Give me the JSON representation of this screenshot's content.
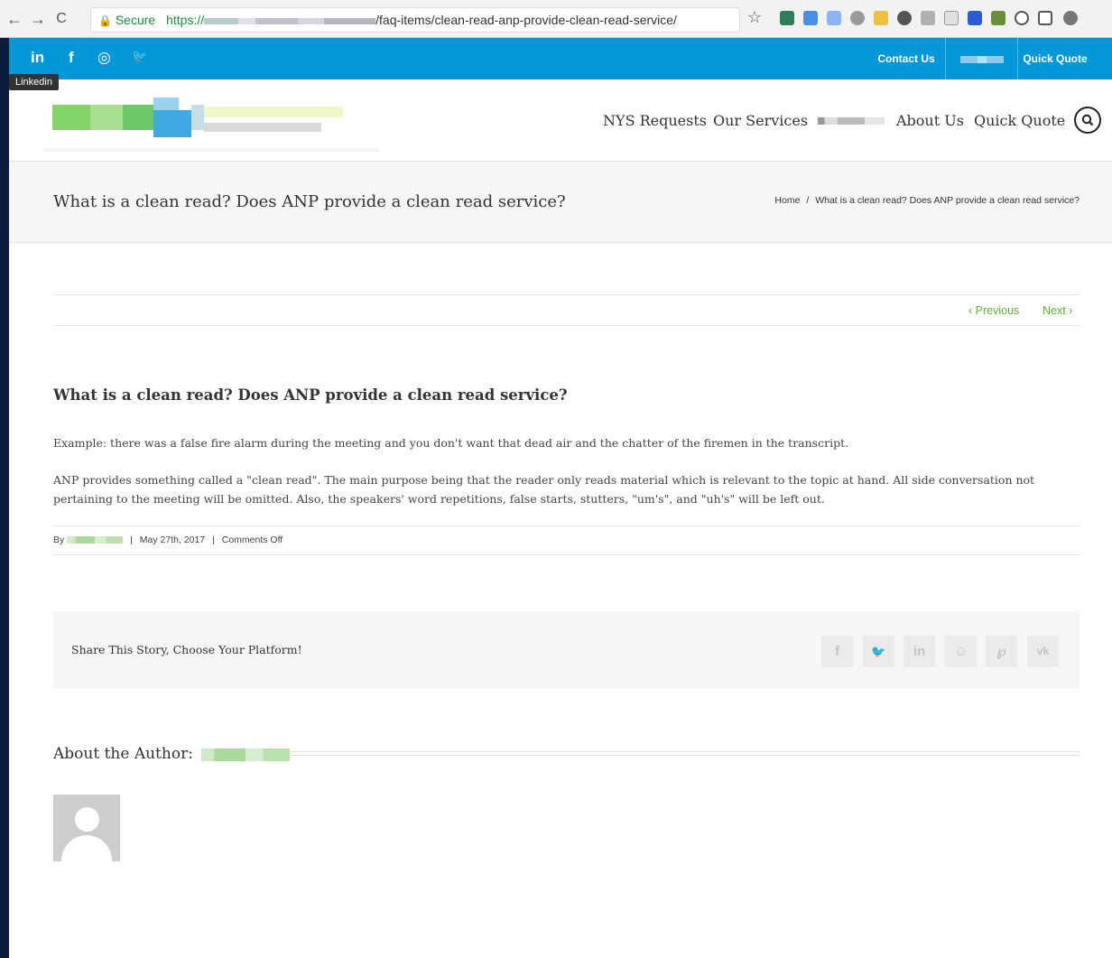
{
  "browser": {
    "back_icon": "←",
    "forward_icon": "→",
    "reload_icon": "C",
    "secure_label": "Secure",
    "url_protocol": "https://",
    "url_path": "/faq-items/clean-read-anp-provide-clean-read-service/",
    "star_icon": "☆"
  },
  "topbar": {
    "social": [
      "in",
      "f",
      "◎",
      "🐦"
    ],
    "tooltip": "Linkedin",
    "contact_label": "Contact Us",
    "quick_quote_label": "Quick Quote",
    "color": "#0497d8"
  },
  "nav": {
    "items": [
      "NYS Requests",
      "Our Services",
      "About Us",
      "Quick Quote"
    ],
    "search_icon": "search-icon"
  },
  "titlebar": {
    "title": "What is a clean read? Does ANP provide a clean read service?",
    "breadcrumb_home": "Home",
    "breadcrumb_sep": "/",
    "breadcrumb_current": "What is a clean read? Does ANP provide a clean read service?"
  },
  "pager": {
    "previous": "‹ Previous",
    "next": "Next ›",
    "color": "#5fae3b"
  },
  "post": {
    "title": "What is a clean read? Does ANP provide a clean read service?",
    "paragraph1": "Example: there was a false fire alarm during the meeting and you don't want that dead air and the chatter of the firemen in the transcript.",
    "paragraph2": "ANP provides something called a \"clean read\". The main purpose being that the reader only reads material which is relevant to the topic at hand. All side conversation not pertaining to the meeting will be omitted. Also, the speakers' word repetitions, false starts, stutters, \"um's\", and \"uh's\" will be left out.",
    "meta_by": "By",
    "meta_sep": "|",
    "meta_date": "May 27th, 2017",
    "meta_comments": "Comments Off"
  },
  "share": {
    "text": "Share This Story, Choose Your Platform!",
    "icons": [
      "f",
      "🐦",
      "in",
      "☺",
      "℘",
      "vk"
    ]
  },
  "author": {
    "heading": "About the Author:"
  }
}
